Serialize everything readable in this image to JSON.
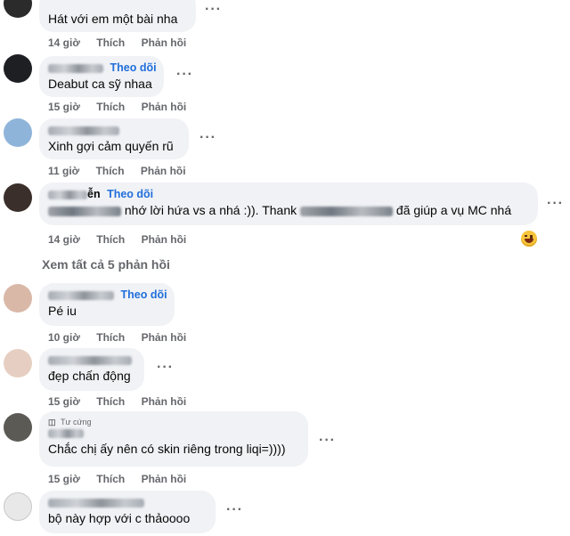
{
  "comments": [
    {
      "text": "Hát với em một bài nha",
      "time": "14 giờ",
      "like": "Thích",
      "reply": "Phản hồi",
      "follow": ""
    },
    {
      "text": "Deabut ca sỹ nhaa",
      "time": "15 giờ",
      "like": "Thích",
      "reply": "Phản hồi",
      "follow": "Theo dõi"
    },
    {
      "text": "Xinh gợi cảm quyến rũ",
      "time": "11 giờ",
      "like": "Thích",
      "reply": "Phản hồi",
      "follow": ""
    },
    {
      "name_suffix": "ễn",
      "text_a": "nhớ lời hứa vs a nhá :)). Thank",
      "text_b": "đã giúp a vụ MC nhá",
      "time": "14 giờ",
      "like": "Thích",
      "reply": "Phản hồi",
      "follow": "Theo dõi",
      "emoji": "grinning-face-emoji"
    },
    {
      "text": "Pé iu",
      "time": "10 giờ",
      "like": "Thích",
      "reply": "Phản hồi",
      "follow": "Theo dõi"
    },
    {
      "text": "đẹp chấn động",
      "time": "15 giờ",
      "like": "Thích",
      "reply": "Phản hồi",
      "follow": ""
    },
    {
      "badge": "Tư cứng",
      "text": "Chắc chị ấy nên có skin riêng trong liqi=))))",
      "time": "15 giờ",
      "like": "Thích",
      "reply": "Phản hồi",
      "follow": ""
    },
    {
      "text": "bộ này hợp với c thảoooo",
      "time": "15 giờ",
      "like": "Thích",
      "reply": "Phản hồi",
      "follow": ""
    }
  ],
  "view_all_replies": "Xem tất cả 5 phản hồi",
  "more_icon": "···"
}
